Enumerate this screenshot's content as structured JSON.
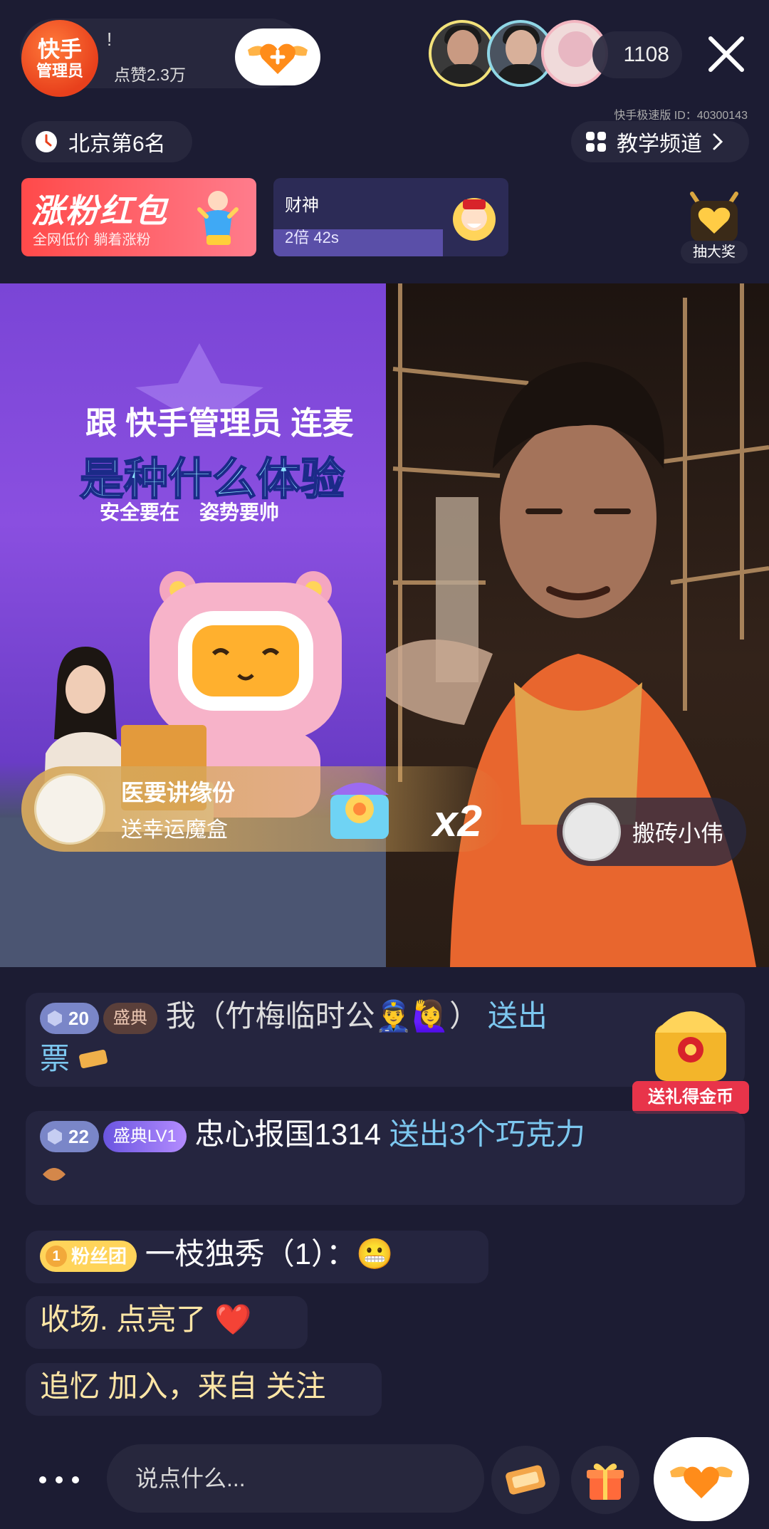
{
  "header": {
    "host_avatar_line1": "快手",
    "host_avatar_line2": "管理员",
    "host_name": "!",
    "likes": "点赞2.3万",
    "viewer_count": "1108",
    "app_id": "快手极速版 ID：40300143"
  },
  "rank": {
    "label": "北京第6名"
  },
  "channel": {
    "label": "教学频道"
  },
  "banners": {
    "redpack_title": "涨粉红包",
    "redpack_sub": "全网低价 躺着涨粉",
    "caishen_title": "财神",
    "caishen_timer": "2倍 42s",
    "caishen_progress": 0.72,
    "lottery_label": "抽大奖"
  },
  "video": {
    "promo_line1": "跟 快手管理员 连麦",
    "promo_line2": "是种什么体验",
    "promo_sub1": "安全要在",
    "promo_sub2": "姿势要帅"
  },
  "gift_toast": {
    "sender": "医要讲缘份",
    "action": "送幸运魔盒",
    "multiplier": "x2"
  },
  "guest": {
    "name": "搬砖小伟"
  },
  "chat": [
    {
      "level": "20",
      "badge": "盛典",
      "text": "我（竹梅临时公👮‍♂️🙋‍♀️）",
      "action": "送出",
      "line2": "票"
    },
    {
      "level": "22",
      "badge": "盛典LV1",
      "text": "忠心报国1314",
      "action": "送出3个巧克力"
    },
    {
      "level": "1",
      "badge": "粉丝团",
      "text": "一枝独秀（1）：😬"
    },
    {
      "text": "收场.  点亮了 ❤️"
    },
    {
      "text": "追忆 加入，来自 关注"
    }
  ],
  "coin_chest": {
    "label": "送礼得金币"
  },
  "bottom": {
    "placeholder": "说点什么...",
    "more_label": "•••"
  },
  "colors": {
    "background": "#1c1c33",
    "accent_orange": "#e8401c",
    "chat_action": "#7cc7ef",
    "gold": "#ffd45a"
  }
}
